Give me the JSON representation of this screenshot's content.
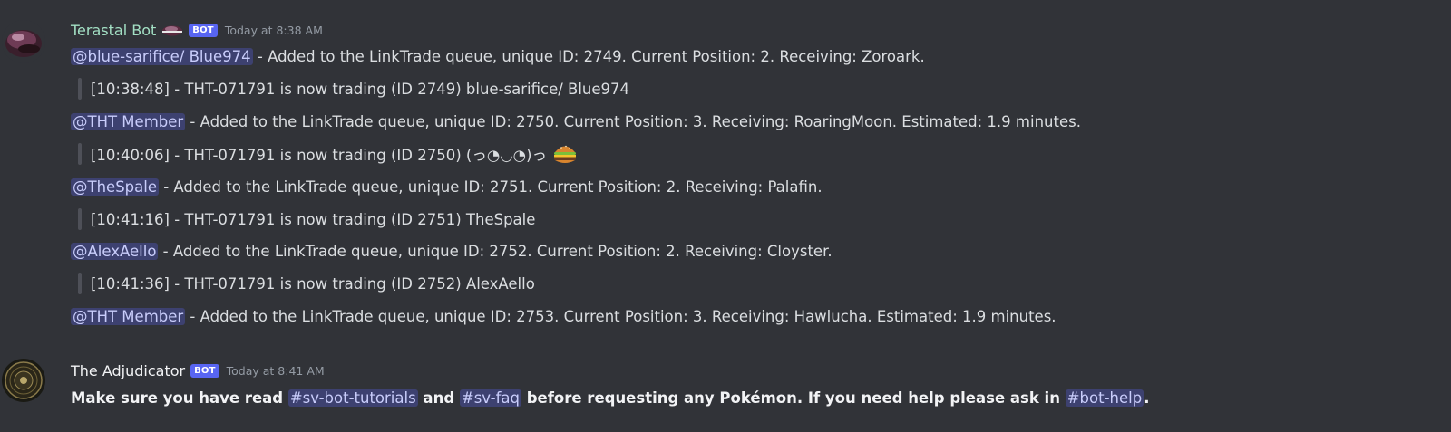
{
  "messages": [
    {
      "author": "Terastal Bot",
      "bot_tag": "BOT",
      "timestamp": "Today at 8:38 AM",
      "author_color": "#a3e0c4",
      "lines": [
        {
          "type": "mention",
          "mention": "@blue-sarifice/ Blue974",
          "text": " - Added to the LinkTrade queue, unique ID: 2749. Current Position: 2. Receiving: Zoroark."
        },
        {
          "type": "quote",
          "text": "[10:38:48] - THT-071791 is now trading (ID 2749) blue-sarifice/ Blue974"
        },
        {
          "type": "mention",
          "mention": "@THT Member",
          "text": " - Added to the LinkTrade queue, unique ID: 2750. Current Position: 3. Receiving: RoaringMoon. Estimated: 1.9 minutes."
        },
        {
          "type": "quote",
          "text": "[10:40:06] - THT-071791 is now trading (ID 2750) (っ◔◡◔)っ",
          "emoji": "hamburger"
        },
        {
          "type": "mention",
          "mention": "@TheSpale",
          "text": " - Added to the LinkTrade queue, unique ID: 2751. Current Position: 2. Receiving: Palafin."
        },
        {
          "type": "quote",
          "text": "[10:41:16] - THT-071791 is now trading (ID 2751) TheSpale"
        },
        {
          "type": "mention",
          "mention": "@AlexAello",
          "text": " - Added to the LinkTrade queue, unique ID: 2752. Current Position: 2. Receiving: Cloyster."
        },
        {
          "type": "quote",
          "text": "[10:41:36] - THT-071791 is now trading (ID 2752) AlexAello"
        },
        {
          "type": "mention",
          "mention": "@THT Member",
          "text": " - Added to the LinkTrade queue, unique ID: 2753. Current Position: 3. Receiving: Hawlucha. Estimated: 1.9 minutes."
        }
      ]
    },
    {
      "author": "The Adjudicator",
      "bot_tag": "BOT",
      "timestamp": "Today at 8:41 AM",
      "author_color": "#f2f3f5",
      "text_1": "Make sure you have read ",
      "channel_1": "#sv-bot-tutorials",
      "text_2": " and ",
      "channel_2": "#sv-faq",
      "text_3": " before requesting any Pokémon. If you need help please ask in ",
      "channel_3": "#bot-help",
      "text_4": "."
    }
  ]
}
